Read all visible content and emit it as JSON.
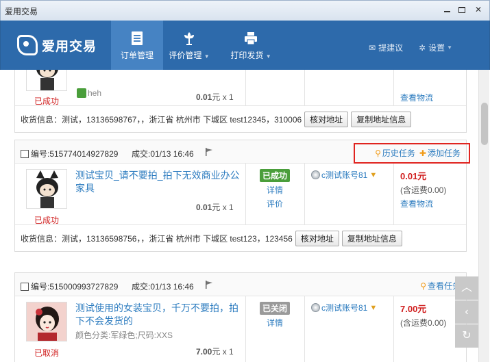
{
  "window": {
    "title": "爱用交易"
  },
  "header": {
    "logo_text": "爱用交易",
    "nav": [
      {
        "label": "订单管理",
        "icon": "order-doc-icon",
        "active": true
      },
      {
        "label": "评价管理",
        "icon": "flower-icon",
        "active": false
      },
      {
        "label": "打印发货",
        "icon": "printer-icon",
        "active": false
      }
    ],
    "suggest_label": "提建议",
    "settings_label": "设置"
  },
  "orders": [
    {
      "state": "已成功",
      "buyer": "heh",
      "price_line": "0.01元 x 1",
      "price_value": "0.01",
      "price_unit": "元 x 1",
      "logistics_link": "查看物流",
      "ship_info": "收货信息：测试，13136598767，，浙江省 杭州市 下城区 test12345，310006",
      "verify_btn": "核对地址",
      "copy_btn": "复制地址信息"
    },
    {
      "order_no": "编号:515774014927829",
      "deal_time": "成交:01/13 16:46",
      "history_task": "历史任务",
      "add_task": "添加任务",
      "title": "测试宝贝_请不要拍_拍下无效商业办公家具",
      "price_value": "0.01",
      "price_unit": "元 x 1",
      "state": "已成功",
      "status_badge": "已成功",
      "status_links": [
        "详情",
        "评价"
      ],
      "buyer": "c测试账号81",
      "pay": "0.01元",
      "pay_note": "(含运费0.00)",
      "logistics_link": "查看物流",
      "ship_info": "收货信息：测试，13136598756，，浙江省 杭州市 下城区 test123，123456",
      "verify_btn": "核对地址",
      "copy_btn": "复制地址信息"
    },
    {
      "order_no": "编号:515000993727829",
      "deal_time": "成交:01/13 16:46",
      "view_task": "查看任务",
      "title": "测试使用的女装宝贝，千万不要拍，拍下不会发货的",
      "sku": "颜色分类:军绿色;尺码:XXS",
      "price_value": "7.00",
      "price_unit": "元 x 1",
      "state": "已取消",
      "status_badge": "已关闭",
      "status_links": [
        "详情"
      ],
      "buyer": "c测试账号81",
      "pay": "7.00元",
      "pay_note": "(含运费0.00)"
    }
  ],
  "colors": {
    "header_bg": "#2d6aab",
    "nav_active": "#4683c3",
    "link": "#2b7bbf",
    "alert_red": "#d01e1e",
    "highlight": "#e0241f",
    "success": "#4a9e3b"
  }
}
